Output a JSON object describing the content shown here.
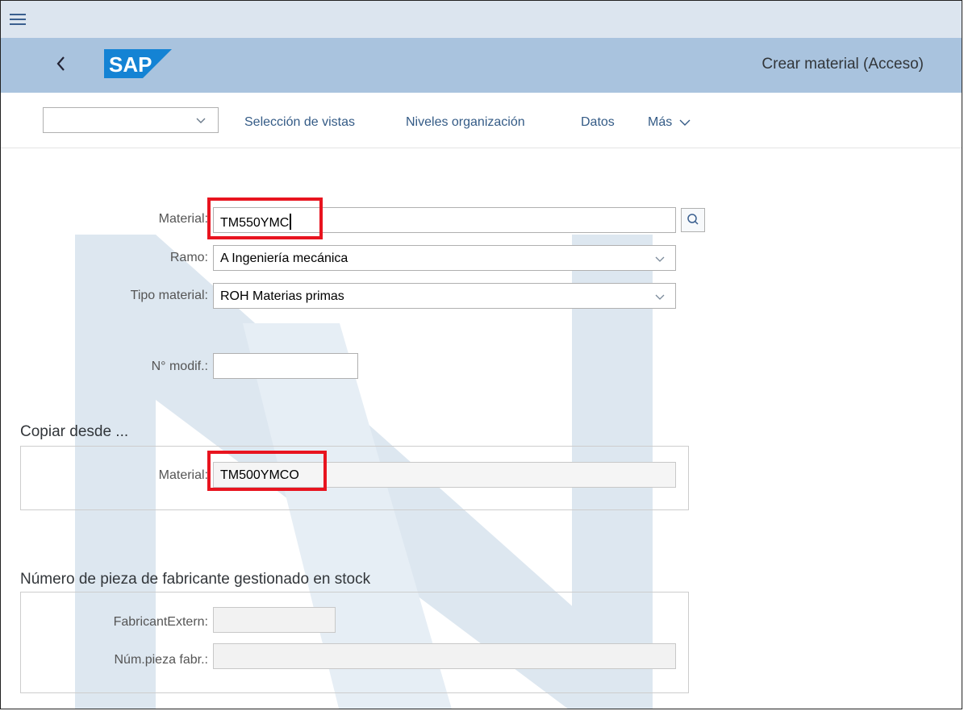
{
  "header": {
    "menu_icon": "hamburger-icon",
    "back_icon": "chevron-left-icon",
    "logo_text": "SAP",
    "title": "Crear material (Acceso)"
  },
  "toolbar": {
    "select_value": "",
    "items": [
      "Selección de vistas",
      "Niveles organización",
      "Datos",
      "Más"
    ]
  },
  "form": {
    "material_label": "Material:",
    "material_value": "TM550YMC",
    "ramo_label": "Ramo:",
    "ramo_value": "A Ingeniería mecánica",
    "tipo_label": "Tipo material:",
    "tipo_value": "ROH Materias primas",
    "modif_label": "N° modif.:",
    "modif_value": ""
  },
  "copy_group": {
    "title": "Copiar desde ...",
    "material_label": "Material:",
    "material_value": "TM500YMCO"
  },
  "mpn_group": {
    "title": "Número de pieza de fabricante gestionado en stock",
    "fabricant_label": "FabricantExtern:",
    "fabricant_value": "",
    "pieza_label": "Núm.pieza fabr.:",
    "pieza_value": ""
  },
  "colors": {
    "shellbar": "#a9c3de",
    "topbar": "#dce5ef",
    "link": "#345b86",
    "highlight": "#e8141f",
    "watermark": "#dde7f0"
  }
}
